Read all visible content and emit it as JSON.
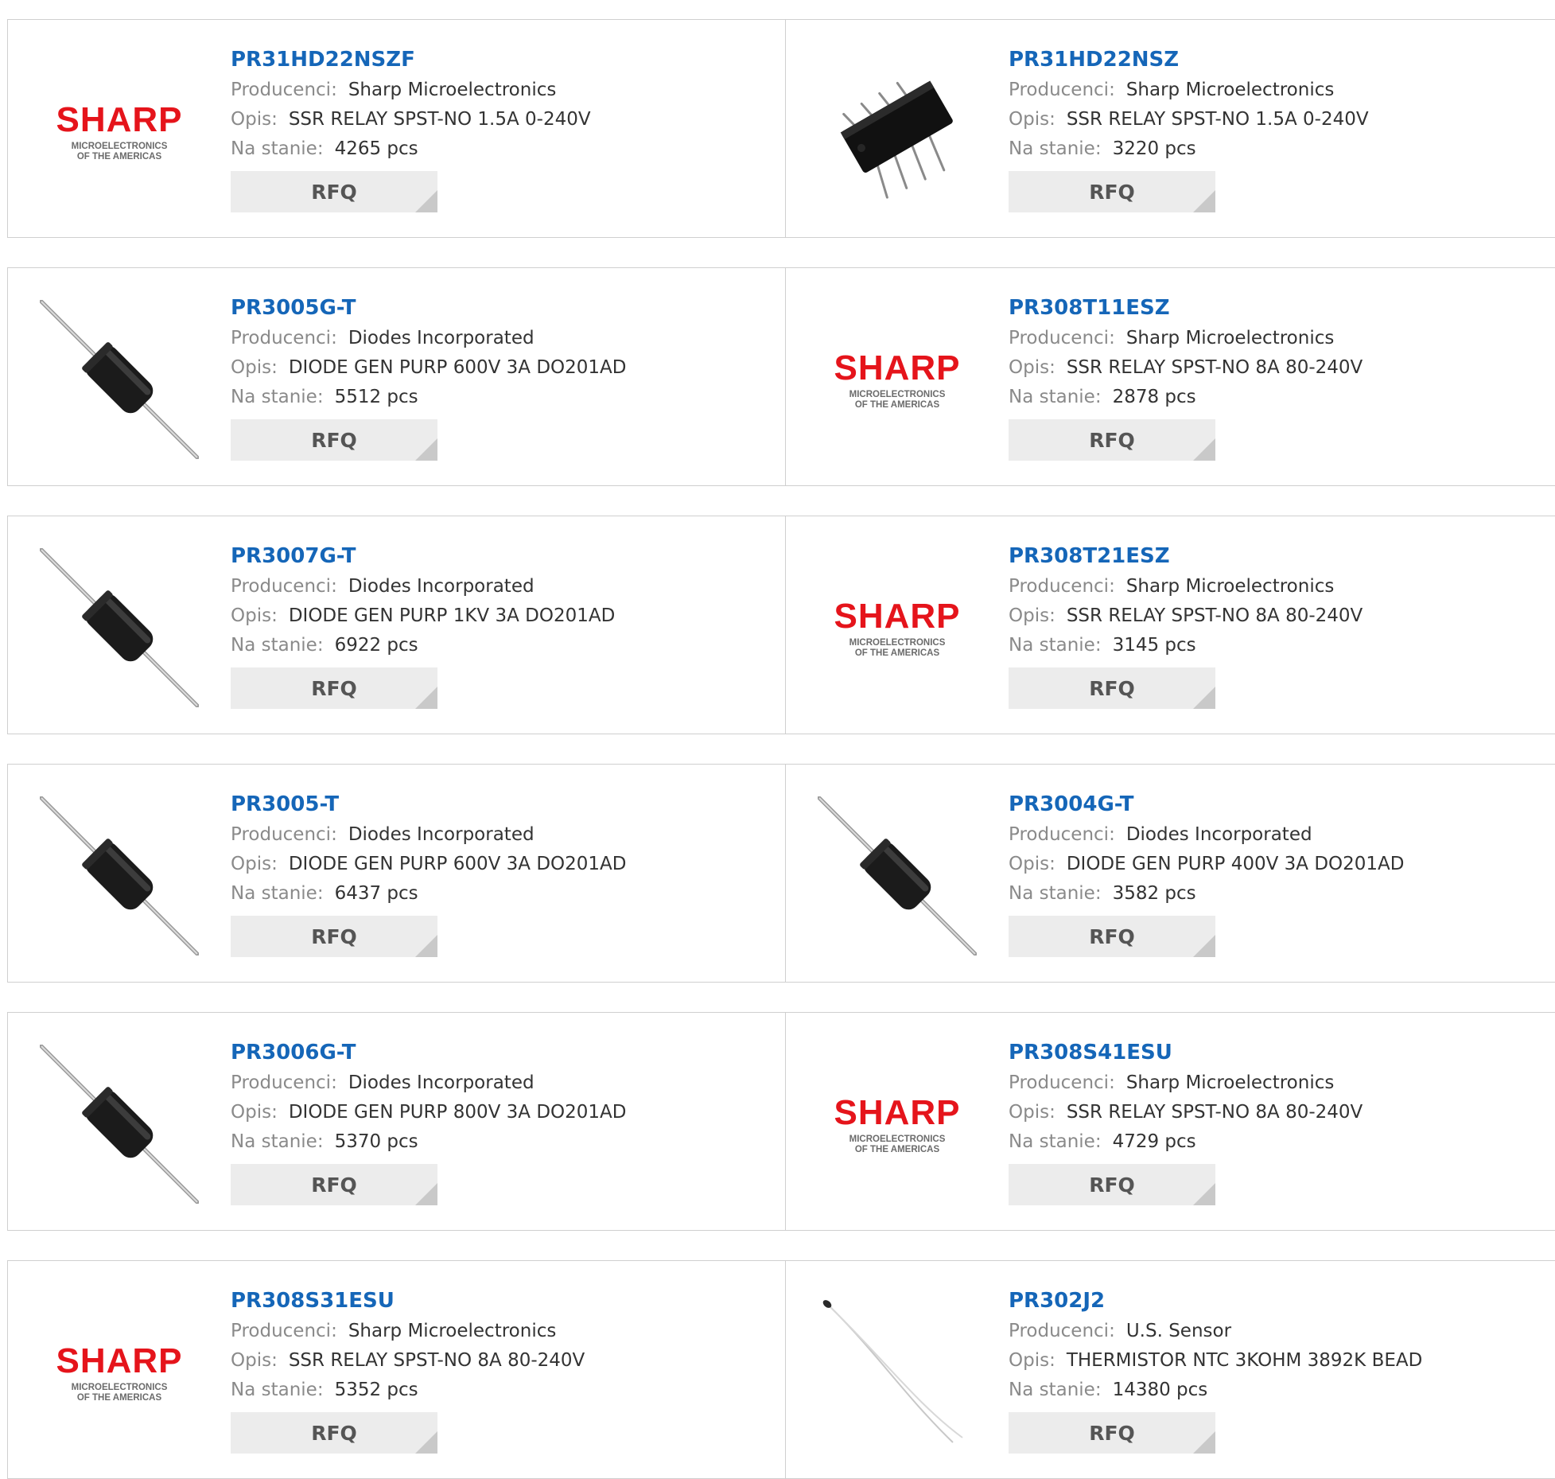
{
  "labels": {
    "manufacturer": "Producenci:",
    "description": "Opis:",
    "stock": "Na stanie:",
    "rfq": "RFQ"
  },
  "logo": {
    "brand": "SHARP",
    "line1": "MICROELECTRONICS",
    "line2": "OF THE AMERICAS"
  },
  "colors": {
    "part_link": "#1566b8",
    "sharp_red": "#e5141b",
    "rfq_bg": "#ececec"
  },
  "products": [
    {
      "part": "PR31HD22NSZF",
      "manufacturer": "Sharp Microelectronics",
      "description": "SSR RELAY SPST-NO 1.5A 0-240V",
      "stock": "4265 pcs",
      "image": "sharp-logo"
    },
    {
      "part": "PR31HD22NSZ",
      "manufacturer": "Sharp Microelectronics",
      "description": "SSR RELAY SPST-NO 1.5A 0-240V",
      "stock": "3220 pcs",
      "image": "dip-chip"
    },
    {
      "part": "PR3005G-T",
      "manufacturer": "Diodes Incorporated",
      "description": "DIODE GEN PURP 600V 3A DO201AD",
      "stock": "5512 pcs",
      "image": "axial-diode"
    },
    {
      "part": "PR308T11ESZ",
      "manufacturer": "Sharp Microelectronics",
      "description": "SSR RELAY SPST-NO 8A 80-240V",
      "stock": "2878 pcs",
      "image": "sharp-logo"
    },
    {
      "part": "PR3007G-T",
      "manufacturer": "Diodes Incorporated",
      "description": "DIODE GEN PURP 1KV 3A DO201AD",
      "stock": "6922 pcs",
      "image": "axial-diode"
    },
    {
      "part": "PR308T21ESZ",
      "manufacturer": "Sharp Microelectronics",
      "description": "SSR RELAY SPST-NO 8A 80-240V",
      "stock": "3145 pcs",
      "image": "sharp-logo"
    },
    {
      "part": "PR3005-T",
      "manufacturer": "Diodes Incorporated",
      "description": "DIODE GEN PURP 600V 3A DO201AD",
      "stock": "6437 pcs",
      "image": "axial-diode"
    },
    {
      "part": "PR3004G-T",
      "manufacturer": "Diodes Incorporated",
      "description": "DIODE GEN PURP 400V 3A DO201AD",
      "stock": "3582 pcs",
      "image": "axial-diode"
    },
    {
      "part": "PR3006G-T",
      "manufacturer": "Diodes Incorporated",
      "description": "DIODE GEN PURP 800V 3A DO201AD",
      "stock": "5370 pcs",
      "image": "axial-diode"
    },
    {
      "part": "PR308S41ESU",
      "manufacturer": "Sharp Microelectronics",
      "description": "SSR RELAY SPST-NO 8A 80-240V",
      "stock": "4729 pcs",
      "image": "sharp-logo"
    },
    {
      "part": "PR308S31ESU",
      "manufacturer": "Sharp Microelectronics",
      "description": "SSR RELAY SPST-NO 8A 80-240V",
      "stock": "5352 pcs",
      "image": "sharp-logo"
    },
    {
      "part": "PR302J2",
      "manufacturer": "U.S. Sensor",
      "description": "THERMISTOR NTC 3KOHM 3892K BEAD",
      "stock": "14380 pcs",
      "image": "thermistor"
    }
  ]
}
